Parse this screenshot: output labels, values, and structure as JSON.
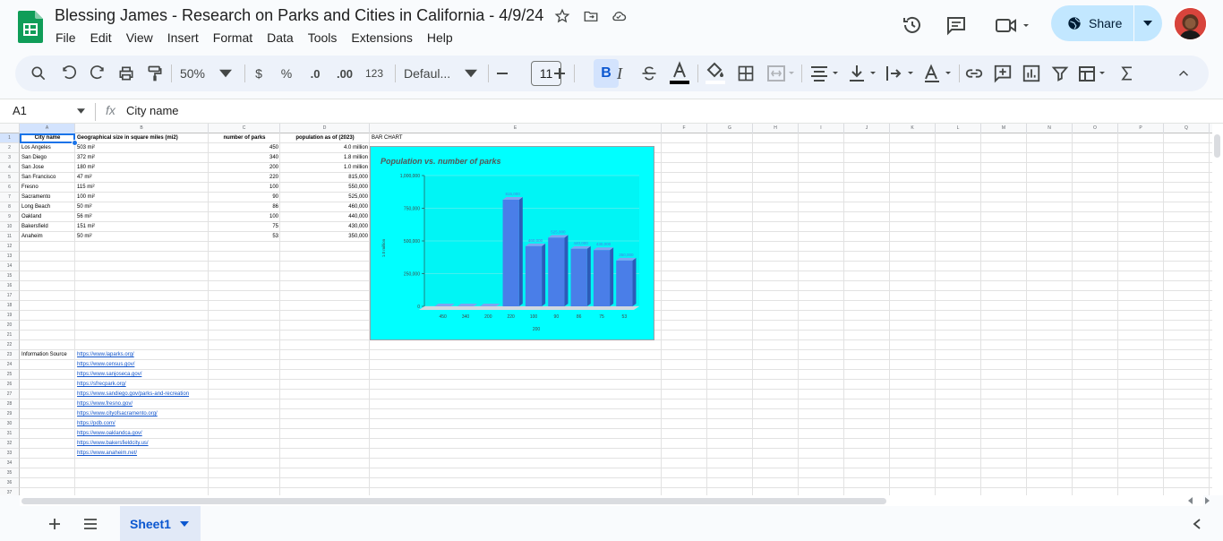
{
  "title_bar": {
    "doc_title": "Blessing James - Research on Parks and Cities in California - 4/9/24",
    "share_label": "Share"
  },
  "menu": [
    "File",
    "Edit",
    "View",
    "Insert",
    "Format",
    "Data",
    "Tools",
    "Extensions",
    "Help"
  ],
  "toolbar": {
    "zoom": "50%",
    "currency": "$",
    "percent": "%",
    "dec_decrease": ".0",
    "dec_increase": ".00",
    "number_format": "123",
    "font": "Defaul...",
    "font_size": "11",
    "bold": "B",
    "italic": "I"
  },
  "formula_bar": {
    "name_box": "A1",
    "fx": "fx",
    "content": "City name"
  },
  "columns": [
    "A",
    "B",
    "C",
    "D",
    "E",
    "F",
    "G",
    "H",
    "I",
    "J",
    "K",
    "L",
    "M",
    "N",
    "O",
    "P",
    "Q"
  ],
  "rows": [
    "1",
    "2",
    "3",
    "4",
    "5",
    "6",
    "7",
    "8",
    "9",
    "10",
    "11",
    "12",
    "13",
    "14",
    "15",
    "16",
    "17",
    "18",
    "19",
    "20",
    "21",
    "22",
    "23",
    "24",
    "25",
    "26",
    "27",
    "28",
    "29",
    "30",
    "31",
    "32",
    "33",
    "34",
    "35",
    "36",
    "37"
  ],
  "table": {
    "headers": [
      "City name",
      "Geographical size in square miles (mi2)",
      "number of parks",
      "population as of (2023)"
    ],
    "extra_header": "BAR CHART",
    "rows": [
      [
        "Los Angeles",
        "503 mi²",
        "450",
        "4.0 million"
      ],
      [
        "San Diego",
        "372 mi²",
        "340",
        "1.8 million"
      ],
      [
        "San Jose",
        "180 mi²",
        "200",
        "1.0 million"
      ],
      [
        "San Francisco",
        "47 mi²",
        "220",
        "815,000"
      ],
      [
        "Fresno",
        "115 mi²",
        "100",
        "550,000"
      ],
      [
        "Sacramento",
        "100 mi²",
        "90",
        "525,000"
      ],
      [
        "Long Beach",
        "50 mi²",
        "86",
        "460,000"
      ],
      [
        "Oakland",
        "56 mi²",
        "100",
        "440,000"
      ],
      [
        "Bakersfield",
        "151 mi²",
        "75",
        "430,000"
      ],
      [
        "Anaheim",
        "50 mi²",
        "53",
        "350,000"
      ]
    ]
  },
  "sources": {
    "label": "Information Source",
    "links": [
      "https://www.laparks.org/",
      "https://www.census.gov/",
      "https://www.sanjoseca.gov/",
      "https://sfrecpark.org/",
      "https://www.sandiego.gov/parks-and-recreation",
      "https://www.fresno.gov/",
      "https://www.cityofsacramento.org/",
      "https://pdb.com/",
      "https://www.oaklandca.gov/",
      "https://www.bakersfieldcity.us/",
      "https://www.anaheim.net/"
    ]
  },
  "chart_data": {
    "type": "bar",
    "title": "Population vs. number of parks",
    "ylabel": "1.0 million",
    "xlabel": "200",
    "categories": [
      "450",
      "340",
      "200",
      "220",
      "100",
      "90",
      "86",
      "75",
      "53"
    ],
    "values": [
      0,
      0,
      0,
      815000,
      460000,
      525000,
      440000,
      430000,
      350000
    ],
    "data_labels": [
      "",
      "",
      "",
      "815,000",
      "460,000",
      "525,000",
      "440,000",
      "430,000",
      "350,000"
    ],
    "yticks": [
      "0",
      "250,000",
      "500,000",
      "750,000",
      "1,000,000"
    ],
    "ylim": [
      0,
      1000000
    ],
    "bar_color": "#4a7ee8",
    "background": "#00ffff"
  },
  "sheet_tab": "Sheet1"
}
